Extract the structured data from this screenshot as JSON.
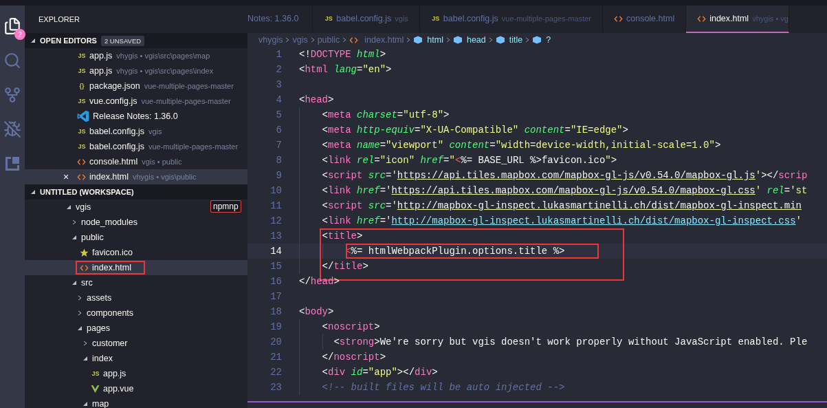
{
  "activity_bar": [
    {
      "kind": "files",
      "selected": true,
      "badge": "2"
    },
    {
      "kind": "search",
      "selected": false
    },
    {
      "kind": "source-control",
      "selected": false
    },
    {
      "kind": "debug",
      "selected": false
    },
    {
      "kind": "extensions",
      "selected": false
    }
  ],
  "sidebar": {
    "title": "EXPLORER",
    "open_editors": {
      "title": "OPEN EDITORS",
      "badge": "2 UNSAVED",
      "items": [
        {
          "kind": "js",
          "glyph": "JS",
          "name": "app.js",
          "detail": "vhygis • vgis\\src\\pages\\map",
          "selected": false
        },
        {
          "kind": "js",
          "glyph": "JS",
          "name": "app.js",
          "detail": "vhygis • vgis\\src\\pages\\index",
          "selected": false
        },
        {
          "kind": "json",
          "glyph": "{}",
          "name": "package.json",
          "detail": "vue-multiple-pages-master",
          "selected": false
        },
        {
          "kind": "js",
          "glyph": "JS",
          "name": "vue.config.js",
          "detail": "vue-multiple-pages-master",
          "selected": false
        },
        {
          "kind": "vscode",
          "name": "Release Notes: 1.36.0",
          "selected": false
        },
        {
          "kind": "js",
          "glyph": "JS",
          "name": "babel.config.js",
          "detail": "vgis",
          "selected": false
        },
        {
          "kind": "js",
          "glyph": "JS",
          "name": "babel.config.js",
          "detail": "vue-multiple-pages-master",
          "selected": false
        },
        {
          "kind": "html",
          "name": "console.html",
          "detail": "vgis • public",
          "selected": false
        },
        {
          "kind": "html",
          "name": "index.html",
          "detail": "vhygis • vgis\\public",
          "selected": true,
          "close": "×"
        }
      ]
    },
    "workspace": {
      "title": "UNTITLED (WORKSPACE)",
      "tree": [
        {
          "kind": "folder",
          "name": "vgis",
          "expanded": true,
          "selected": false,
          "tooltip": "npmnp",
          "children": [
            {
              "kind": "folder",
              "name": "node_modules",
              "expanded": false,
              "selected": false
            },
            {
              "kind": "folder",
              "name": "public",
              "expanded": true,
              "selected": false,
              "children": [
                {
                  "kind": "star",
                  "name": "favicon.ico",
                  "selected": false
                },
                {
                  "kind": "html",
                  "name": "index.html",
                  "selected": true,
                  "annotated": true
                }
              ]
            },
            {
              "kind": "folder",
              "name": "src",
              "expanded": true,
              "selected": false,
              "children": [
                {
                  "kind": "folder",
                  "name": "assets",
                  "expanded": false,
                  "selected": false
                },
                {
                  "kind": "folder",
                  "name": "components",
                  "expanded": false,
                  "selected": false
                },
                {
                  "kind": "folder",
                  "name": "pages",
                  "expanded": true,
                  "selected": false,
                  "children": [
                    {
                      "kind": "folder",
                      "name": "customer",
                      "expanded": false,
                      "selected": false
                    },
                    {
                      "kind": "folder",
                      "name": "index",
                      "expanded": true,
                      "selected": false,
                      "children": [
                        {
                          "kind": "js",
                          "glyph": "JS",
                          "name": "app.js",
                          "selected": false
                        },
                        {
                          "kind": "vue",
                          "name": "app.vue",
                          "selected": false
                        }
                      ]
                    },
                    {
                      "kind": "folder",
                      "name": "map",
                      "expanded": true,
                      "selected": false
                    }
                  ]
                }
              ]
            }
          ]
        }
      ]
    }
  },
  "tabs": [
    {
      "kind": "plain",
      "label": "Notes: 1.36.0",
      "selected": false
    },
    {
      "kind": "js",
      "glyph": "JS",
      "label": "babel.config.js",
      "detail": "vgis",
      "selected": false
    },
    {
      "kind": "js",
      "glyph": "JS",
      "label": "babel.config.js",
      "detail": "vue-multiple-pages-master",
      "selected": false
    },
    {
      "kind": "html",
      "label": "console.html",
      "selected": false
    },
    {
      "kind": "html",
      "label": "index.html",
      "detail": "vhygis • vg",
      "selected": true
    }
  ],
  "breadcrumbs": [
    {
      "kind": "folder",
      "label": "vhygis"
    },
    {
      "kind": "folder",
      "label": "vgis"
    },
    {
      "kind": "folder",
      "label": "public"
    },
    {
      "kind": "file",
      "label": "index.html"
    },
    {
      "kind": "symbol",
      "label": "html"
    },
    {
      "kind": "symbol",
      "label": "head"
    },
    {
      "kind": "symbol",
      "label": "title"
    },
    {
      "kind": "symbol",
      "label": "?"
    }
  ],
  "code": [
    {
      "number": "1",
      "tokens": [
        {
          "kind": "p",
          "text": "<!"
        },
        {
          "kind": "tag",
          "text": "DOCTYPE"
        },
        {
          "kind": "attr",
          "text": " html"
        },
        {
          "kind": "p",
          "text": ">"
        }
      ]
    },
    {
      "number": "2",
      "tokens": [
        {
          "kind": "p",
          "text": "<"
        },
        {
          "kind": "tag",
          "text": "html"
        },
        {
          "kind": "attr",
          "text": " lang"
        },
        {
          "kind": "p",
          "text": "="
        },
        {
          "kind": "str",
          "text": "\"en\""
        },
        {
          "kind": "p",
          "text": ">"
        }
      ]
    },
    {
      "number": "3"
    },
    {
      "number": "4",
      "tokens": [
        {
          "kind": "p",
          "text": "<"
        },
        {
          "kind": "tag",
          "text": "head"
        },
        {
          "kind": "p",
          "text": ">"
        }
      ]
    },
    {
      "number": "5",
      "tokens": [
        {
          "kind": "p",
          "text": "    <"
        },
        {
          "kind": "tag",
          "text": "meta"
        },
        {
          "kind": "attr",
          "text": " charset"
        },
        {
          "kind": "p",
          "text": "="
        },
        {
          "kind": "str",
          "text": "\"utf-8\""
        },
        {
          "kind": "p",
          "text": ">"
        }
      ]
    },
    {
      "number": "6",
      "tokens": [
        {
          "kind": "p",
          "text": "    <"
        },
        {
          "kind": "tag",
          "text": "meta"
        },
        {
          "kind": "attr",
          "text": " http-equiv"
        },
        {
          "kind": "p",
          "text": "="
        },
        {
          "kind": "str",
          "text": "\"X-UA-Compatible\""
        },
        {
          "kind": "attr",
          "text": " content"
        },
        {
          "kind": "p",
          "text": "="
        },
        {
          "kind": "str",
          "text": "\"IE=edge\""
        },
        {
          "kind": "p",
          "text": ">"
        }
      ]
    },
    {
      "number": "7",
      "tokens": [
        {
          "kind": "p",
          "text": "    <"
        },
        {
          "kind": "tag",
          "text": "meta"
        },
        {
          "kind": "attr",
          "text": " name"
        },
        {
          "kind": "p",
          "text": "="
        },
        {
          "kind": "str",
          "text": "\"viewport\""
        },
        {
          "kind": "attr",
          "text": " content"
        },
        {
          "kind": "p",
          "text": "="
        },
        {
          "kind": "str",
          "text": "\"width=device-width,initial-scale=1.0\""
        },
        {
          "kind": "p",
          "text": ">"
        }
      ]
    },
    {
      "number": "8",
      "tokens": [
        {
          "kind": "p",
          "text": "    <"
        },
        {
          "kind": "tag",
          "text": "link"
        },
        {
          "kind": "attr",
          "text": " rel"
        },
        {
          "kind": "p",
          "text": "="
        },
        {
          "kind": "str",
          "text": "\"icon\""
        },
        {
          "kind": "attr",
          "text": " href"
        },
        {
          "kind": "p",
          "text": "="
        },
        {
          "kind": "str",
          "text": "\""
        },
        {
          "kind": "err",
          "text": "<"
        },
        {
          "kind": "text",
          "text": "%= BASE_URL %>favicon.ico"
        },
        {
          "kind": "str",
          "text": "\""
        },
        {
          "kind": "p",
          "text": ">"
        }
      ]
    },
    {
      "number": "9",
      "tokens": [
        {
          "kind": "p",
          "text": "    <"
        },
        {
          "kind": "tag",
          "text": "script"
        },
        {
          "kind": "attr",
          "text": " src"
        },
        {
          "kind": "p",
          "text": "="
        },
        {
          "kind": "str",
          "text": "'"
        },
        {
          "kind": "link",
          "text": "https://api.tiles.mapbox.com/mapbox-gl-js/v0.54.0/mapbox-gl.js"
        },
        {
          "kind": "str",
          "text": "'"
        },
        {
          "kind": "p",
          "text": "></"
        },
        {
          "kind": "tag",
          "text": "scrip"
        }
      ]
    },
    {
      "number": "10",
      "tokens": [
        {
          "kind": "p",
          "text": "    <"
        },
        {
          "kind": "tag",
          "text": "link"
        },
        {
          "kind": "attr",
          "text": " href"
        },
        {
          "kind": "p",
          "text": "="
        },
        {
          "kind": "str",
          "text": "'"
        },
        {
          "kind": "link",
          "text": "https://api.tiles.mapbox.com/mapbox-gl-js/v0.54.0/mapbox-gl.css"
        },
        {
          "kind": "str",
          "text": "'"
        },
        {
          "kind": "attr",
          "text": " rel"
        },
        {
          "kind": "p",
          "text": "="
        },
        {
          "kind": "str",
          "text": "'st"
        }
      ]
    },
    {
      "number": "11",
      "tokens": [
        {
          "kind": "p",
          "text": "    <"
        },
        {
          "kind": "tag",
          "text": "script"
        },
        {
          "kind": "attr",
          "text": " src"
        },
        {
          "kind": "p",
          "text": "="
        },
        {
          "kind": "str",
          "text": "'"
        },
        {
          "kind": "link",
          "text": "http://mapbox-gl-inspect.lukasmartinelli.ch/dist/mapbox-gl-inspect.min"
        }
      ]
    },
    {
      "number": "12",
      "tokens": [
        {
          "kind": "p",
          "text": "    <"
        },
        {
          "kind": "tag",
          "text": "link"
        },
        {
          "kind": "attr",
          "text": " href"
        },
        {
          "kind": "p",
          "text": "="
        },
        {
          "kind": "str",
          "text": "'"
        },
        {
          "kind": "link-blue",
          "text": "http://mapbox-gl-inspect.lukasmartinelli.ch/dist/mapbox-gl-inspect.css"
        },
        {
          "kind": "str",
          "text": "'"
        }
      ]
    },
    {
      "number": "13",
      "boxed": true,
      "tokens": [
        {
          "kind": "p",
          "text": "    <"
        },
        {
          "kind": "tag",
          "text": "title"
        },
        {
          "kind": "p",
          "text": ">"
        }
      ]
    },
    {
      "number": "14",
      "boxed": true,
      "current": true,
      "inner_box": true,
      "tokens": [
        {
          "kind": "err",
          "text": "        <"
        },
        {
          "kind": "text",
          "text": "%= htmlWebpackPlugin.options.title %>"
        }
      ]
    },
    {
      "number": "15",
      "boxed": true,
      "tokens": [
        {
          "kind": "p",
          "text": "    </"
        },
        {
          "kind": "tag",
          "text": "title"
        },
        {
          "kind": "p",
          "text": ">"
        }
      ]
    },
    {
      "number": "16",
      "tokens": [
        {
          "kind": "p",
          "text": "</"
        },
        {
          "kind": "tag",
          "text": "head"
        },
        {
          "kind": "p",
          "text": ">"
        }
      ]
    },
    {
      "number": "17"
    },
    {
      "number": "18",
      "tokens": [
        {
          "kind": "p",
          "text": "<"
        },
        {
          "kind": "tag",
          "text": "body"
        },
        {
          "kind": "p",
          "text": ">"
        }
      ]
    },
    {
      "number": "19",
      "tokens": [
        {
          "kind": "p",
          "text": "    <"
        },
        {
          "kind": "tag",
          "text": "noscript"
        },
        {
          "kind": "p",
          "text": ">"
        }
      ]
    },
    {
      "number": "20",
      "tokens": [
        {
          "kind": "p",
          "text": "      <"
        },
        {
          "kind": "tag",
          "text": "strong"
        },
        {
          "kind": "p",
          "text": ">"
        },
        {
          "kind": "text",
          "text": "We're sorry but vgis doesn't work properly without JavaScript enabled. Ple"
        }
      ]
    },
    {
      "number": "21",
      "tokens": [
        {
          "kind": "p",
          "text": "    </"
        },
        {
          "kind": "tag",
          "text": "noscript"
        },
        {
          "kind": "p",
          "text": ">"
        }
      ]
    },
    {
      "number": "22",
      "tokens": [
        {
          "kind": "p",
          "text": "    <"
        },
        {
          "kind": "tag",
          "text": "div"
        },
        {
          "kind": "attr",
          "text": " id"
        },
        {
          "kind": "p",
          "text": "="
        },
        {
          "kind": "str",
          "text": "\"app\""
        },
        {
          "kind": "p",
          "text": "></"
        },
        {
          "kind": "tag",
          "text": "div"
        },
        {
          "kind": "p",
          "text": ">"
        }
      ]
    },
    {
      "number": "23",
      "tokens": [
        {
          "kind": "comment",
          "text": "    <!-- built files will be auto injected -->"
        }
      ]
    }
  ]
}
